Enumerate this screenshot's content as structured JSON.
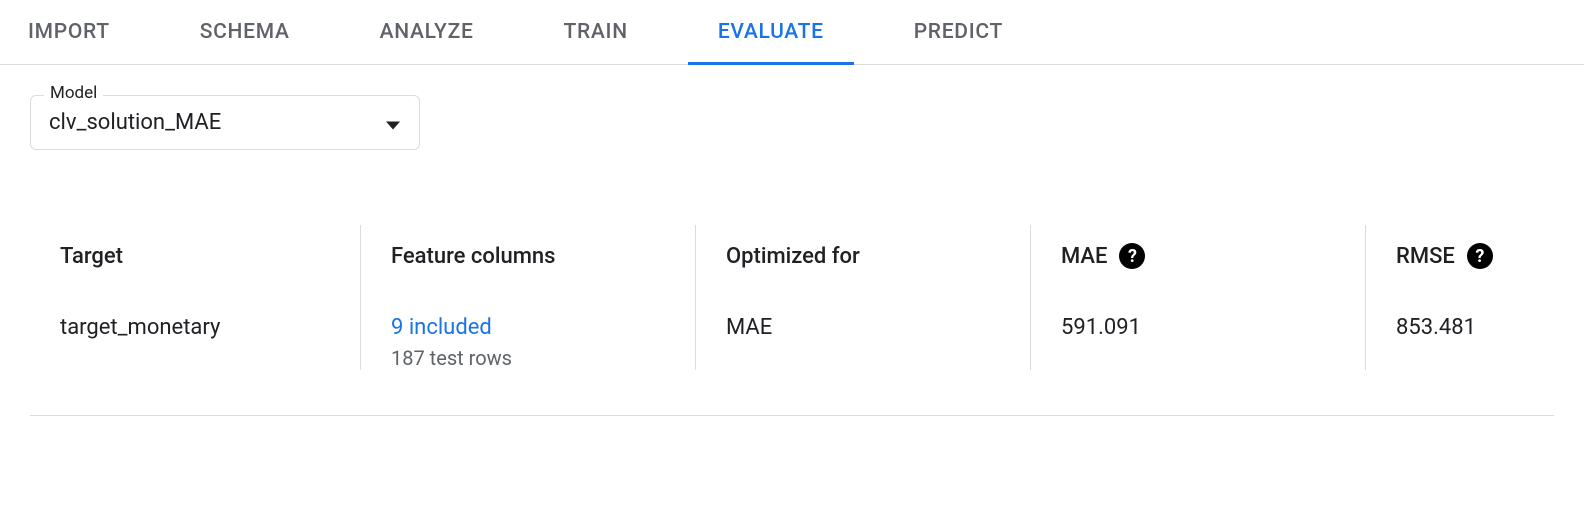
{
  "tabs": {
    "import": "IMPORT",
    "schema": "SCHEMA",
    "analyze": "ANALYZE",
    "train": "TRAIN",
    "evaluate": "EVALUATE",
    "predict": "PREDICT"
  },
  "model": {
    "label": "Model",
    "selected": "clv_solution_MAE"
  },
  "metrics": {
    "target": {
      "header": "Target",
      "value": "target_monetary"
    },
    "features": {
      "header": "Feature columns",
      "link": "9 included",
      "sub": "187 test rows"
    },
    "optimized": {
      "header": "Optimized for",
      "value": "MAE"
    },
    "mae": {
      "header": "MAE",
      "value": "591.091"
    },
    "rmse": {
      "header": "RMSE",
      "value": "853.481"
    }
  }
}
